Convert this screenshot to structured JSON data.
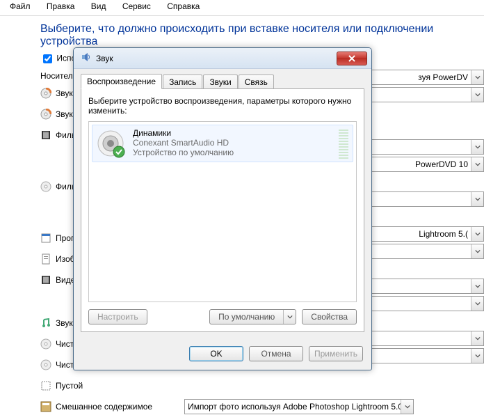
{
  "menu": [
    "Файл",
    "Правка",
    "Вид",
    "Сервис",
    "Справка"
  ],
  "page": {
    "title": "Выберите, что должно происходить при вставке носителя или подключении устройства",
    "useAutorun": "Использовать автозапуск для всех носителей и устройств",
    "sectionHeader": "Носители",
    "rows": [
      {
        "icon": "disc-color",
        "label": "Звуково"
      },
      {
        "icon": "disc-color",
        "label": "Звуково"
      },
      {
        "icon": "film",
        "label": "Фильм н"
      },
      {
        "icon": "disc",
        "label": "Фильм н"
      },
      {
        "icon": "app",
        "label": "Програм"
      },
      {
        "icon": "sheet",
        "label": "Изобра"
      },
      {
        "icon": "film",
        "label": "Видеоф"
      },
      {
        "icon": "music",
        "label": "Звуковы"
      },
      {
        "icon": "disc",
        "label": "Чистый"
      },
      {
        "icon": "disc",
        "label": "Чистый"
      },
      {
        "icon": "box",
        "label": "Пустой"
      },
      {
        "icon": "mix",
        "label": "Смешанное содержимое"
      }
    ],
    "combos": [
      {
        "text": "зуя PowerDV"
      },
      {
        "text": ""
      },
      {
        "text": ""
      },
      {
        "text": "PowerDVD 10"
      },
      {
        "text": ""
      },
      {
        "text": "Lightroom 5.("
      },
      {
        "text": ""
      },
      {
        "text": ""
      },
      {
        "text": ""
      },
      {
        "text": ""
      },
      {
        "text": ""
      }
    ],
    "lastCombo": "Импорт фото используя Adobe Photoshop Lightroom 5.0"
  },
  "dialog": {
    "title": "Звук",
    "tabs": [
      "Воспроизведение",
      "Запись",
      "Звуки",
      "Связь"
    ],
    "activeTab": 0,
    "instruction": "Выберите устройство воспроизведения, параметры которого нужно изменить:",
    "device": {
      "name": "Динамики",
      "driver": "Conexant SmartAudio HD",
      "status": "Устройство по умолчанию"
    },
    "buttons": {
      "configure": "Настроить",
      "default": "По умолчанию",
      "properties": "Свойства",
      "ok": "OK",
      "cancel": "Отмена",
      "apply": "Применить"
    }
  }
}
